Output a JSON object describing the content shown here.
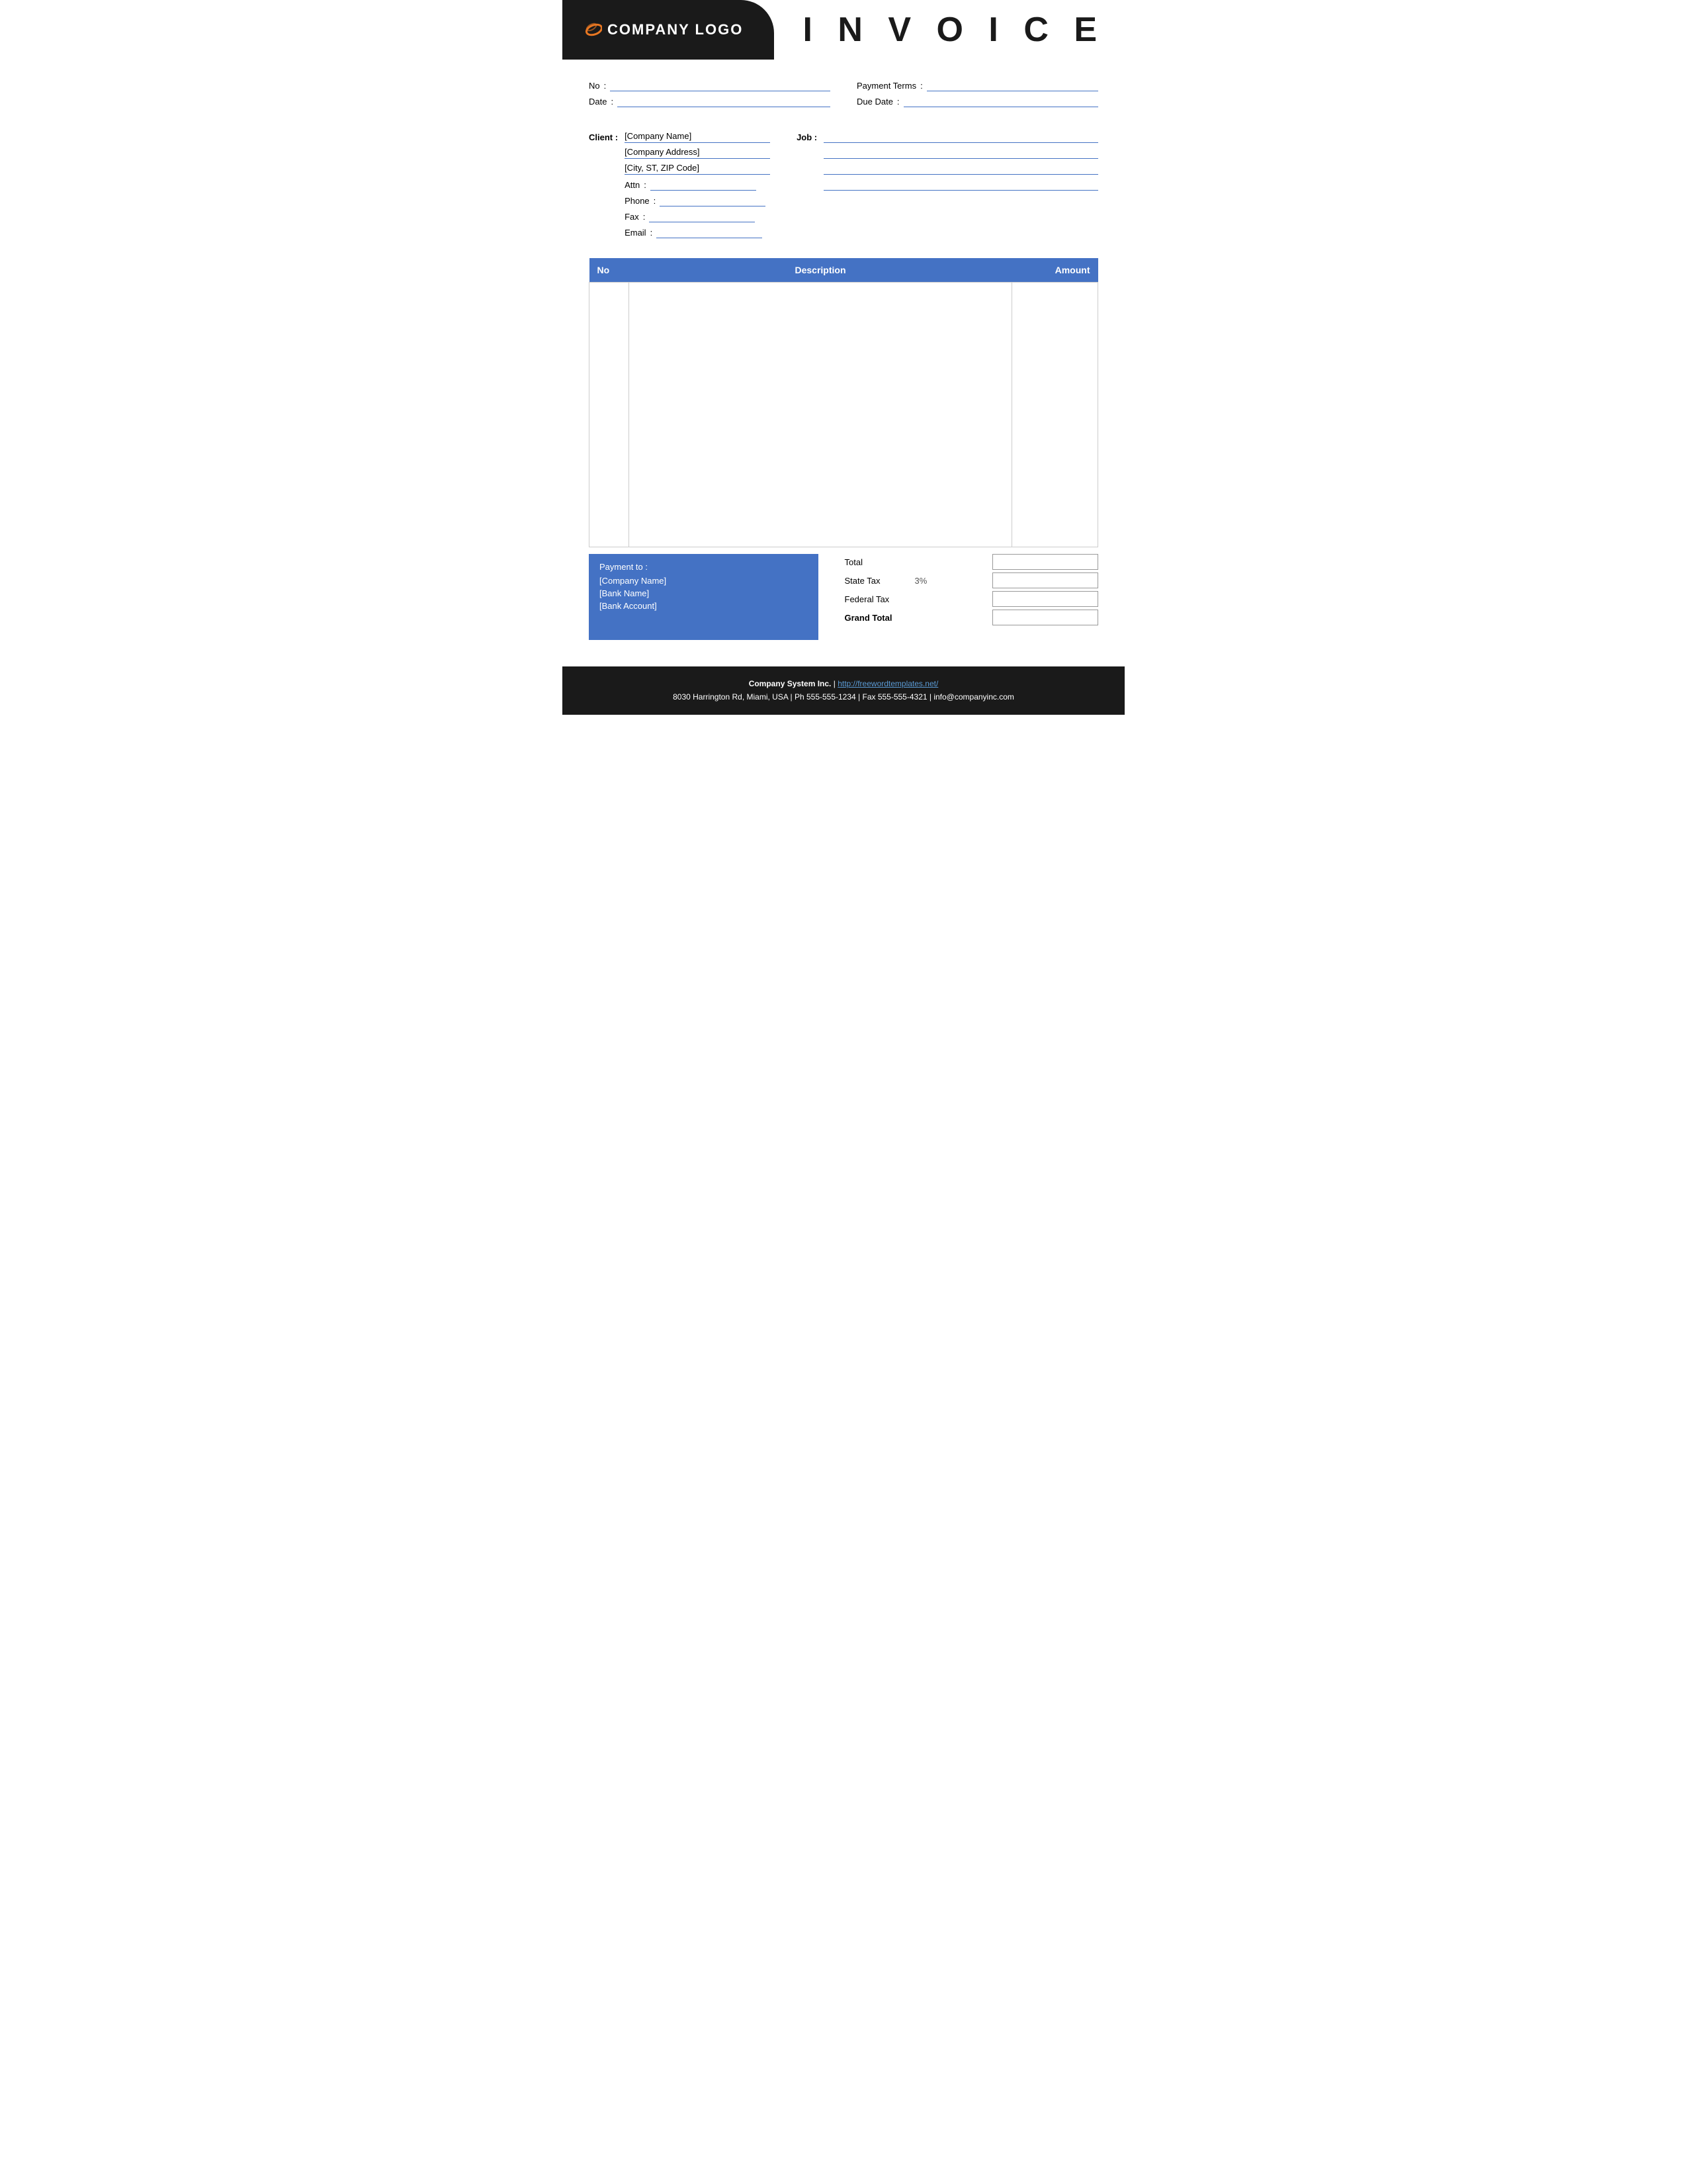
{
  "header": {
    "logo_text": "COMPANY LOGO",
    "invoice_title": "I N V O I C E"
  },
  "info": {
    "no_label": "No",
    "no_colon": ":",
    "payment_terms_label": "Payment  Terms",
    "payment_terms_colon": ":",
    "date_label": "Date",
    "date_colon": ":",
    "due_date_label": "Due Date",
    "due_date_colon": ":"
  },
  "client": {
    "label": "Client :",
    "company_name": "[Company Name]",
    "company_address": "[Company Address]",
    "city_zip": "[City, ST, ZIP Code]",
    "attn_label": "Attn",
    "attn_colon": ":",
    "phone_label": "Phone",
    "phone_colon": ":",
    "fax_label": "Fax",
    "fax_colon": ":",
    "email_label": "Email",
    "email_colon": ":"
  },
  "job": {
    "label": "Job :"
  },
  "table": {
    "col_no": "No",
    "col_description": "Description",
    "col_amount": "Amount"
  },
  "payment": {
    "title": "Payment to :",
    "company_name": "[Company Name]",
    "bank_name": "[Bank Name]",
    "bank_account": "[Bank Account]"
  },
  "totals": {
    "total_label": "Total",
    "state_tax_label": "State Tax",
    "state_tax_pct": "3%",
    "federal_tax_label": "Federal Tax",
    "grand_total_label": "Grand Total"
  },
  "footer": {
    "company": "Company System Inc.",
    "separator": "|",
    "website": "http://freewordtemplates.net/",
    "address_line": "8030 Harrington Rd, Miami, USA | Ph 555-555-1234 | Fax 555-555-4321 | info@companyinc.com"
  }
}
